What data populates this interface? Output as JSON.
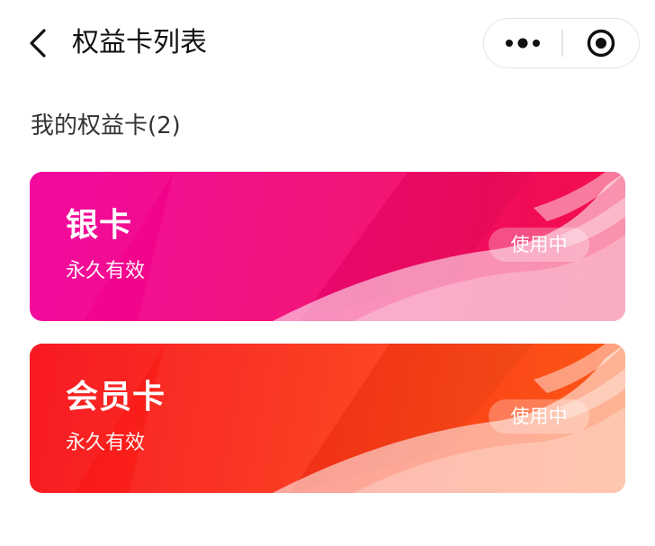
{
  "navbar": {
    "title": "权益卡列表",
    "back_icon": "chevron-left-icon",
    "more_icon": "more-dots-icon",
    "close_icon": "target-circle-icon"
  },
  "section": {
    "title": "我的权益卡(2)"
  },
  "cards": [
    {
      "name": "银卡",
      "validity": "永久有效",
      "status": "使用中",
      "color_start": "#f2019d",
      "color_end": "#f20f47"
    },
    {
      "name": "会员卡",
      "validity": "永久有效",
      "status": "使用中",
      "color_start": "#f8101a",
      "color_end": "#fd5a16"
    }
  ]
}
